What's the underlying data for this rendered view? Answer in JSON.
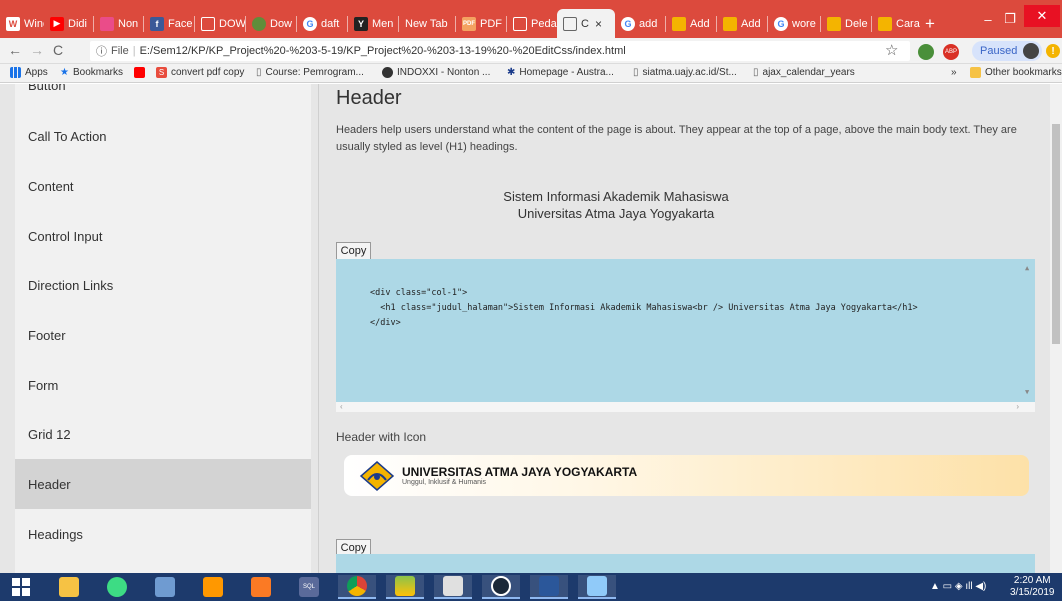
{
  "tabs": [
    {
      "label": "Winc",
      "color": "#ffffff"
    },
    {
      "label": "Didi",
      "color": "#ff0000"
    },
    {
      "label": "Non",
      "color": "#ea4c89"
    },
    {
      "label": "Face",
      "color": "#3b5998"
    },
    {
      "label": "DOW",
      "color": "#bbbbbb"
    },
    {
      "label": "Dow",
      "color": "#5f8d3a"
    },
    {
      "label": "daft",
      "color": "#4285f4"
    },
    {
      "label": "Men",
      "color": "#222222"
    },
    {
      "label": "New Tab",
      "color": ""
    },
    {
      "label": "PDF",
      "color": "#f4a261"
    },
    {
      "label": "Peda",
      "color": "#bbbbbb"
    },
    {
      "label": "C",
      "color": "#bbbbbb"
    },
    {
      "label": "add",
      "color": "#4285f4"
    },
    {
      "label": "Add",
      "color": "#f4b400"
    },
    {
      "label": "Add",
      "color": "#f4b400"
    },
    {
      "label": "wore",
      "color": "#4285f4"
    },
    {
      "label": "Dele",
      "color": "#f4b400"
    },
    {
      "label": "Cara",
      "color": "#f4b400"
    }
  ],
  "address": {
    "scheme_label": "File",
    "url": "E:/Sem12/KP/KP_Project%20-%203-5-19/KP_Project%20-%203-13-19%20-%20EditCss/index.html",
    "profile_label": "Paused"
  },
  "bookmarks": [
    {
      "label": "Apps"
    },
    {
      "label": "Bookmarks"
    },
    {
      "label": ""
    },
    {
      "label": "convert pdf copy"
    },
    {
      "label": "Course: Pemrogram..."
    },
    {
      "label": "INDOXXI - Nonton ..."
    },
    {
      "label": "Homepage - Austra..."
    },
    {
      "label": "siatma.uajy.ac.id/St..."
    },
    {
      "label": "ajax_calendar_years"
    }
  ],
  "bookmarks_more": "»",
  "other_bookmarks": "Other bookmarks",
  "sidebar": {
    "cut_item": "Button",
    "items": [
      {
        "label": "Call To Action"
      },
      {
        "label": "Content"
      },
      {
        "label": "Control Input"
      },
      {
        "label": "Direction Links"
      },
      {
        "label": "Footer"
      },
      {
        "label": "Form"
      },
      {
        "label": "Grid 12"
      },
      {
        "label": "Header"
      },
      {
        "label": "Headings"
      }
    ],
    "active_index": 7
  },
  "main": {
    "title": "Header",
    "description": "Headers help users understand what the content of the page is about. They appear at the top of a page, above the main body text. They are usually styled as level (H1) headings.",
    "demo_line1": "Sistem Informasi Akademik Mahasiswa",
    "demo_line2": "Universitas Atma Jaya Yogyakarta",
    "copy_label": "Copy",
    "code_lines": [
      "<div class=\"col-1\">",
      "  <h1 class=\"judul_halaman\">Sistem Informasi Akademik Mahasiswa<br /> Universitas Atma Jaya Yogyakarta</h1>",
      "</div>"
    ],
    "sub_label": "Header with Icon",
    "banner_title": "UNIVERSITAS ATMA JAYA YOGYAKARTA",
    "banner_subtitle": "Unggul, Inklusif & Humanis",
    "copy_label_2": "Copy"
  },
  "taskbar": {
    "time": "2:20 AM",
    "date": "3/15/2019"
  },
  "colors": {
    "chrome_red": "#dc4a3d",
    "code_bg": "#add8e6",
    "sidebar_active": "#d3d3d3"
  }
}
